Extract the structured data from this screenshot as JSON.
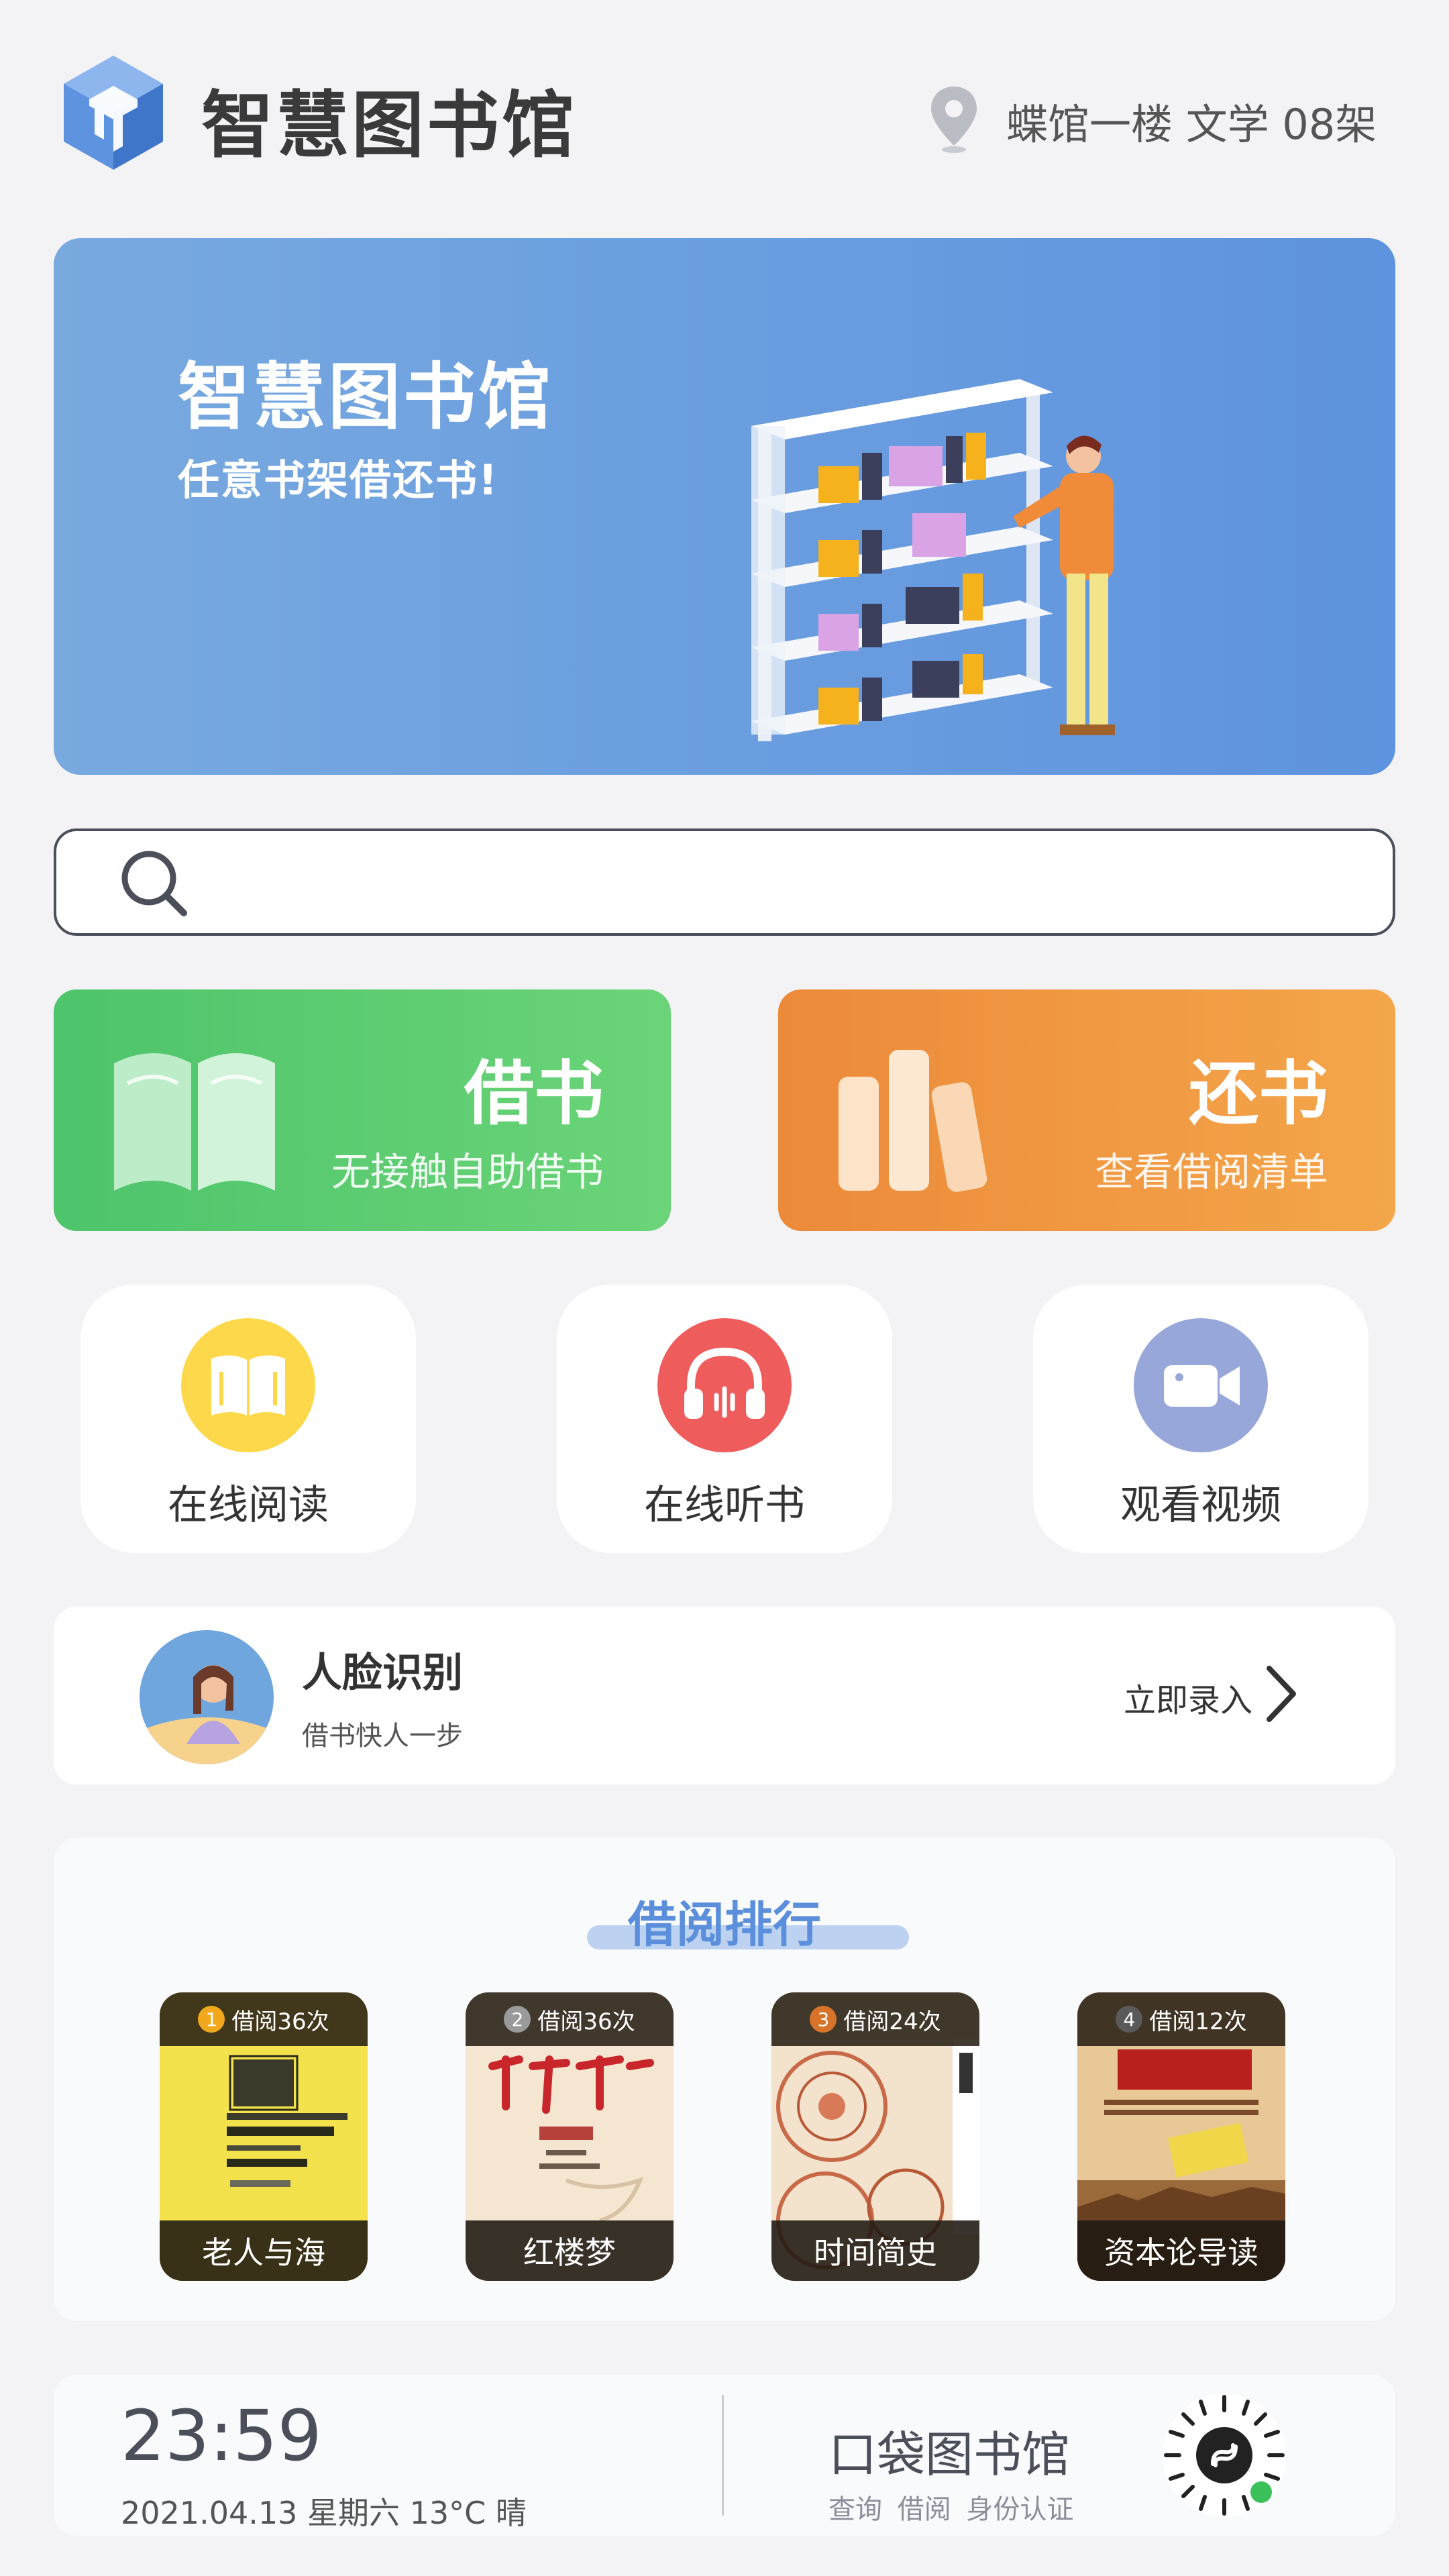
{
  "header": {
    "title": "智慧图书馆",
    "location": "蝶馆一楼  文学  08架"
  },
  "banner": {
    "title": "智慧图书馆",
    "subtitle": "任意书架借还书!"
  },
  "search": {
    "placeholder": "",
    "value": ""
  },
  "actions": {
    "borrow": {
      "title": "借书",
      "subtitle": "无接触自助借书"
    },
    "return": {
      "title": "还书",
      "subtitle": "查看借阅清单"
    }
  },
  "tiles": [
    {
      "label": "在线阅读",
      "icon": "open-book-icon",
      "color": "#fcd84a"
    },
    {
      "label": "在线听书",
      "icon": "headphones-icon",
      "color": "#ef5c5c"
    },
    {
      "label": "观看视频",
      "icon": "video-camera-icon",
      "color": "#97a7d9"
    }
  ],
  "face": {
    "title": "人脸识别",
    "subtitle": "借书快人一步",
    "action": "立即录入"
  },
  "ranking": {
    "title": "借阅排行",
    "books": [
      {
        "rank": "1",
        "count": "借阅36次",
        "name": "老人与海",
        "badge_color": "#f2a81c"
      },
      {
        "rank": "2",
        "count": "借阅36次",
        "name": "红楼梦",
        "badge_color": "#9a9a9a"
      },
      {
        "rank": "3",
        "count": "借阅24次",
        "name": "时间简史",
        "badge_color": "#d8742a"
      },
      {
        "rank": "4",
        "count": "借阅12次",
        "name": "资本论导读",
        "badge_color": "#5a5a5a"
      }
    ]
  },
  "footer": {
    "time": "23:59",
    "date": "2021.04.13  星期六  13°C  晴",
    "pocket_title": "口袋图书馆",
    "pocket_sub": "查询  借阅  身份认证"
  },
  "colors": {
    "accent": "#5b8fdc",
    "borrow": "#4ec46b",
    "return": "#ec8a3a"
  }
}
